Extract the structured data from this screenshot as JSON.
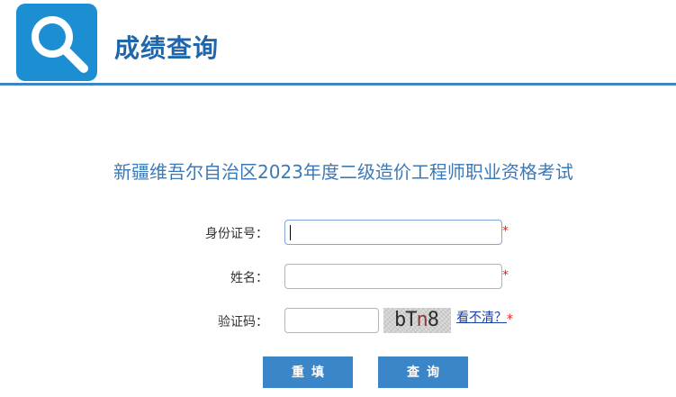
{
  "header": {
    "title": "成绩查询",
    "logo_icon": "search-icon"
  },
  "exam": {
    "title": "新疆维吾尔自治区2023年度二级造价工程师职业资格考试"
  },
  "form": {
    "id_label": "身份证号：",
    "id_value": "",
    "name_label": "姓名：",
    "name_value": "",
    "captcha_label": "验证码：",
    "captcha_value": "",
    "captcha_text_a": "bT",
    "captcha_text_b": "n",
    "captcha_text_c": "8",
    "refresh_link": "看不清？",
    "required_mark": "*"
  },
  "buttons": {
    "reset": "重填",
    "query": "查询"
  },
  "colors": {
    "brand": "#1f67ad",
    "logo_bg": "#1b8fd2",
    "button_bg": "#3a86c9",
    "required": "#e0232b"
  }
}
